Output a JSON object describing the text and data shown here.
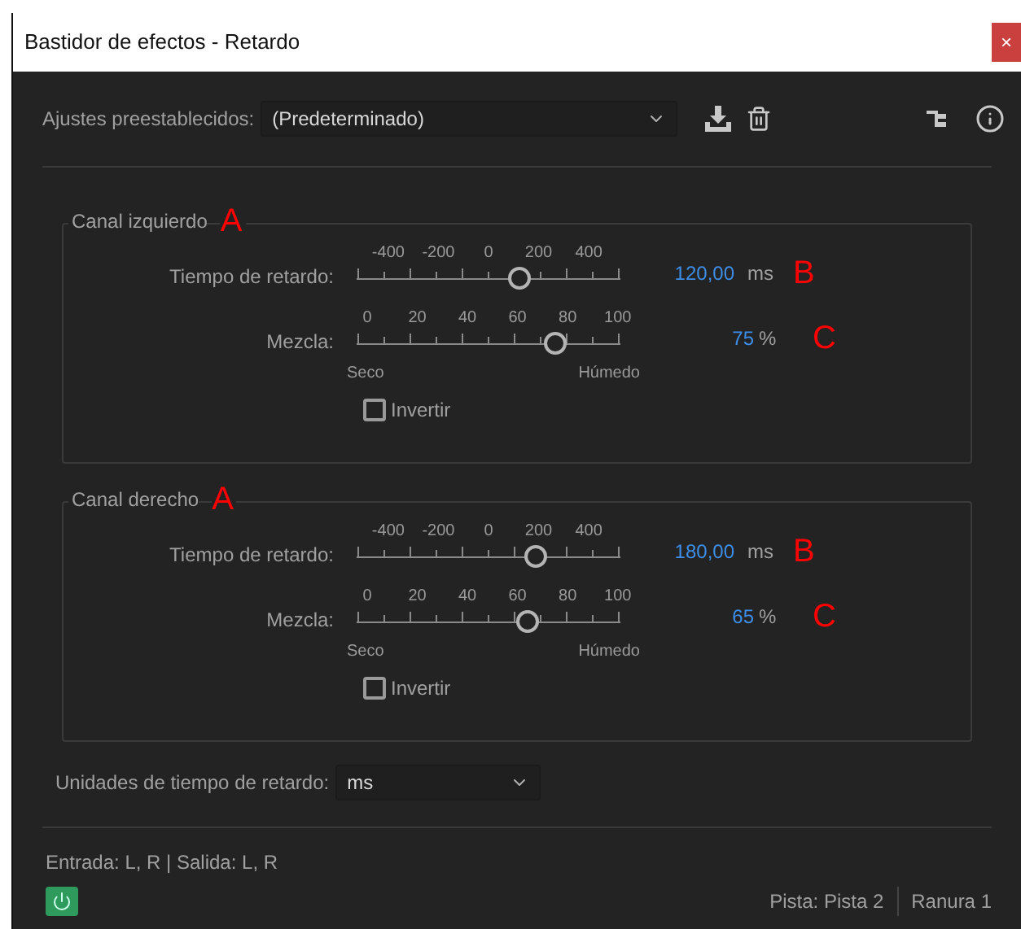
{
  "window": {
    "title": "Bastidor de efectos - Retardo",
    "close": "×"
  },
  "presets": {
    "label": "Ajustes preestablecidos:",
    "value": "(Predeterminado)"
  },
  "channels": [
    {
      "title": "Canal izquierdo",
      "annotation": "A",
      "delay": {
        "label": "Tiempo de retardo:",
        "ticks": [
          "-400",
          "-200",
          "0",
          "200",
          "400"
        ],
        "level": 0.62,
        "value": "120,00",
        "unit": "ms",
        "annotation": "B"
      },
      "mix": {
        "label": "Mezcla:",
        "ticks": [
          "0",
          "20",
          "40",
          "60",
          "80",
          "100"
        ],
        "level": 0.75,
        "value": "75",
        "unit": "%",
        "annotation": "C",
        "left_label": "Seco",
        "right_label": "Húmedo"
      },
      "invert": {
        "label": "Invertir",
        "checked": false
      }
    },
    {
      "title": "Canal derecho",
      "annotation": "A",
      "delay": {
        "label": "Tiempo de retardo:",
        "ticks": [
          "-400",
          "-200",
          "0",
          "200",
          "400"
        ],
        "level": 0.68,
        "value": "180,00",
        "unit": "ms",
        "annotation": "B"
      },
      "mix": {
        "label": "Mezcla:",
        "ticks": [
          "0",
          "20",
          "40",
          "60",
          "80",
          "100"
        ],
        "level": 0.65,
        "value": "65",
        "unit": "%",
        "annotation": "C",
        "left_label": "Seco",
        "right_label": "Húmedo"
      },
      "invert": {
        "label": "Invertir",
        "checked": false
      }
    }
  ],
  "units": {
    "label": "Unidades de tiempo de retardo:",
    "value": "ms"
  },
  "io": "Entrada: L, R | Salida: L, R",
  "status_bar": {
    "power_on": true,
    "track": "Pista: Pista 2",
    "slot": "Ranura 1"
  }
}
